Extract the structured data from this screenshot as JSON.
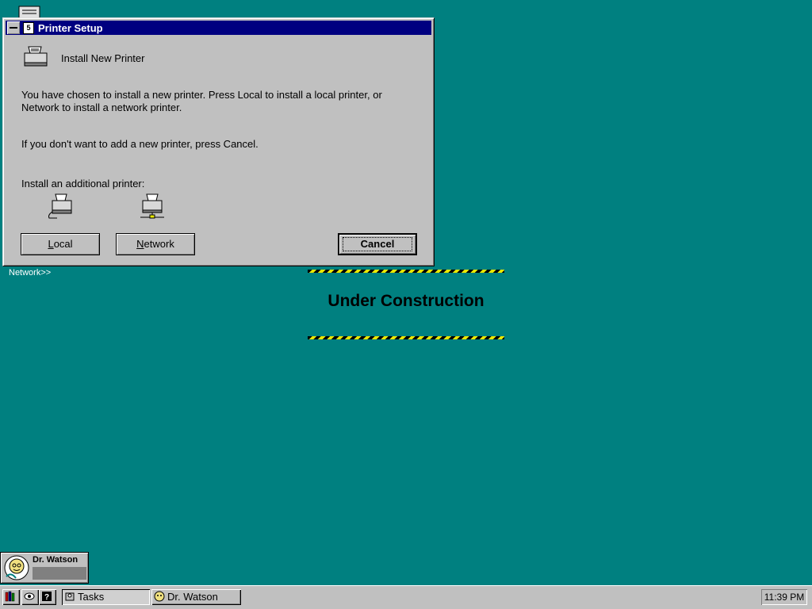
{
  "desktop": {
    "network_label": "Network>>",
    "background_color": "#008080"
  },
  "dialog": {
    "title": "Printer Setup",
    "app_icon_glyph": "5",
    "header": "Install New Printer",
    "message1": "You have chosen to install a new printer. Press Local to install a local printer, or Network to install a network printer.",
    "message2": "If you don't want to add a new printer, press Cancel.",
    "message3": "Install an additional printer:",
    "buttons": {
      "local_prefix": "",
      "local_hotkey": "L",
      "local_rest": "ocal",
      "network_prefix": "",
      "network_hotkey": "N",
      "network_rest": "etwork",
      "cancel": "Cancel"
    }
  },
  "construction": {
    "text": "Under Construction"
  },
  "minimized": {
    "label": "Dr. Watson"
  },
  "taskbar": {
    "tasks_label": "Tasks",
    "drwatson_label": "Dr. Watson",
    "clock": "11:39 PM"
  },
  "colors": {
    "titlebar": "#000080",
    "face": "#c0c0c0",
    "hazard_yellow": "#e8e800"
  }
}
